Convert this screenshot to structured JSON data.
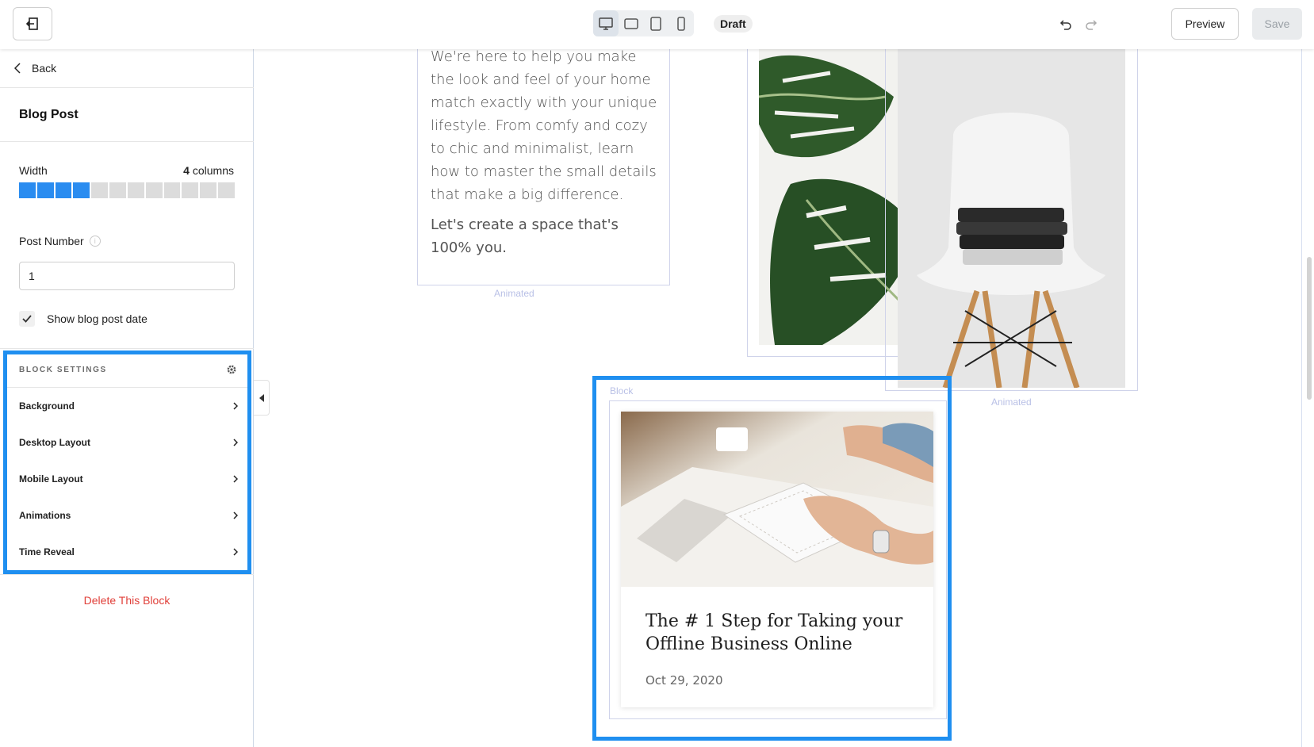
{
  "toolbar": {
    "status": "Draft",
    "preview_label": "Preview",
    "save_label": "Save",
    "devices": [
      "desktop",
      "tablet-landscape",
      "tablet-portrait",
      "mobile"
    ],
    "active_device": "desktop"
  },
  "sidebar": {
    "back_label": "Back",
    "panel_title": "Blog Post",
    "width": {
      "label": "Width",
      "value": "4",
      "unit": " columns",
      "selected": 4,
      "total": 12
    },
    "post_number": {
      "label": "Post Number",
      "value": "1"
    },
    "show_date": {
      "label": "Show blog post date",
      "checked": true
    },
    "block_settings": {
      "title": "BLOCK SETTINGS",
      "items": [
        {
          "label": "Background"
        },
        {
          "label": "Desktop Layout"
        },
        {
          "label": "Mobile Layout"
        },
        {
          "label": "Animations"
        },
        {
          "label": "Time Reveal"
        }
      ]
    },
    "delete_label": "Delete This Block"
  },
  "canvas": {
    "text_block": {
      "paragraph1": "We're here to help you make the look and feel of your home match exactly with your unique lifestyle. From comfy and cozy to chic and minimalist, learn how to master the small details that make a big difference.",
      "paragraph2": "Let's create a space that's 100% you.",
      "animated_label": "Animated"
    },
    "images_animated_label": "Animated",
    "block_label": "Block",
    "blog_post": {
      "title": "The # 1 Step for Taking your Offline Business Online",
      "date": "Oct 29, 2020"
    }
  },
  "colors": {
    "accent": "#1f8ff0",
    "delete": "#e0403a",
    "outline": "#cfd3ea"
  }
}
